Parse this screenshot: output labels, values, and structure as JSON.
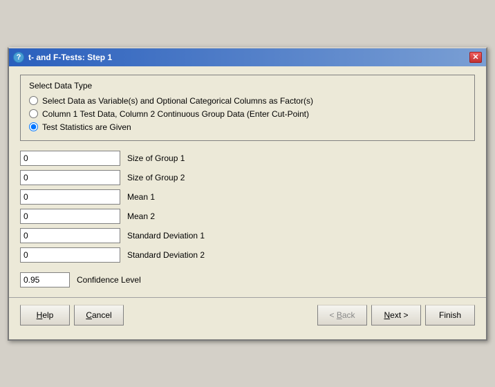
{
  "window": {
    "title": "t- and F-Tests: Step 1",
    "close_label": "✕"
  },
  "group_box": {
    "legend": "Select Data Type",
    "radio_options": [
      {
        "id": "radio1",
        "label": "Select Data as Variable(s) and Optional Categorical Columns as Factor(s)",
        "checked": false
      },
      {
        "id": "radio2",
        "label": "Column 1 Test Data, Column 2 Continuous Group Data (Enter Cut-Point)",
        "checked": false
      },
      {
        "id": "radio3",
        "label": "Test Statistics are Given",
        "checked": true
      }
    ]
  },
  "fields": [
    {
      "id": "group1_size",
      "value": "0",
      "label": "Size of Group 1"
    },
    {
      "id": "group2_size",
      "value": "0",
      "label": "Size of Group 2"
    },
    {
      "id": "mean1",
      "value": "0",
      "label": "Mean 1"
    },
    {
      "id": "mean2",
      "value": "0",
      "label": "Mean 2"
    },
    {
      "id": "sd1",
      "value": "0",
      "label": "Standard Deviation 1"
    },
    {
      "id": "sd2",
      "value": "0",
      "label": "Standard Deviation 2"
    }
  ],
  "confidence": {
    "value": "0.95",
    "label": "Confidence Level"
  },
  "buttons": {
    "help": "Help",
    "cancel": "Cancel",
    "back": "< Back",
    "next": "Next >",
    "finish": "Finish"
  }
}
